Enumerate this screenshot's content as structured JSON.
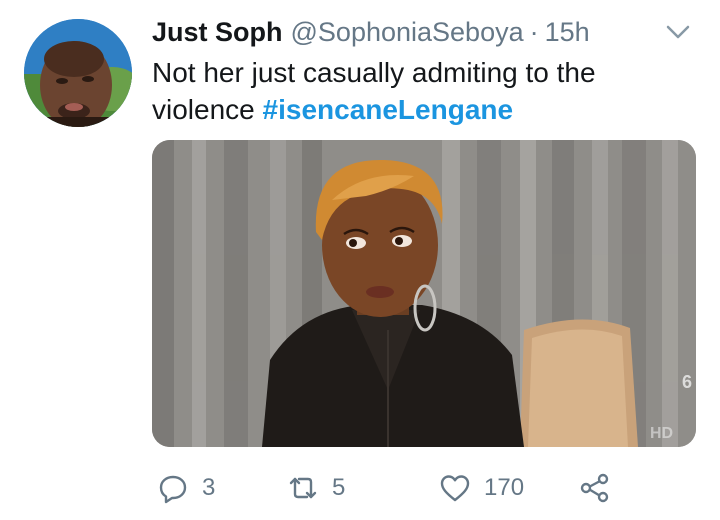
{
  "tweet": {
    "display_name": "Just Soph",
    "handle": "@SophoniaSeboya",
    "separator": "·",
    "time": "15h",
    "text_plain": "Not her just casually admiting to the violence ",
    "hashtag": "#isencaneLengane"
  },
  "media": {
    "watermark_number": "6",
    "watermark_hd": "HD"
  },
  "actions": {
    "reply_count": "3",
    "retweet_count": "5",
    "like_count": "170"
  },
  "icons": {
    "reply": "reply-icon",
    "retweet": "retweet-icon",
    "like": "heart-icon",
    "share": "share-icon",
    "menu": "chevron-down-icon"
  },
  "colors": {
    "hashtag": "#1b95e0",
    "secondary_text": "#657786",
    "primary_text": "#14171a"
  }
}
